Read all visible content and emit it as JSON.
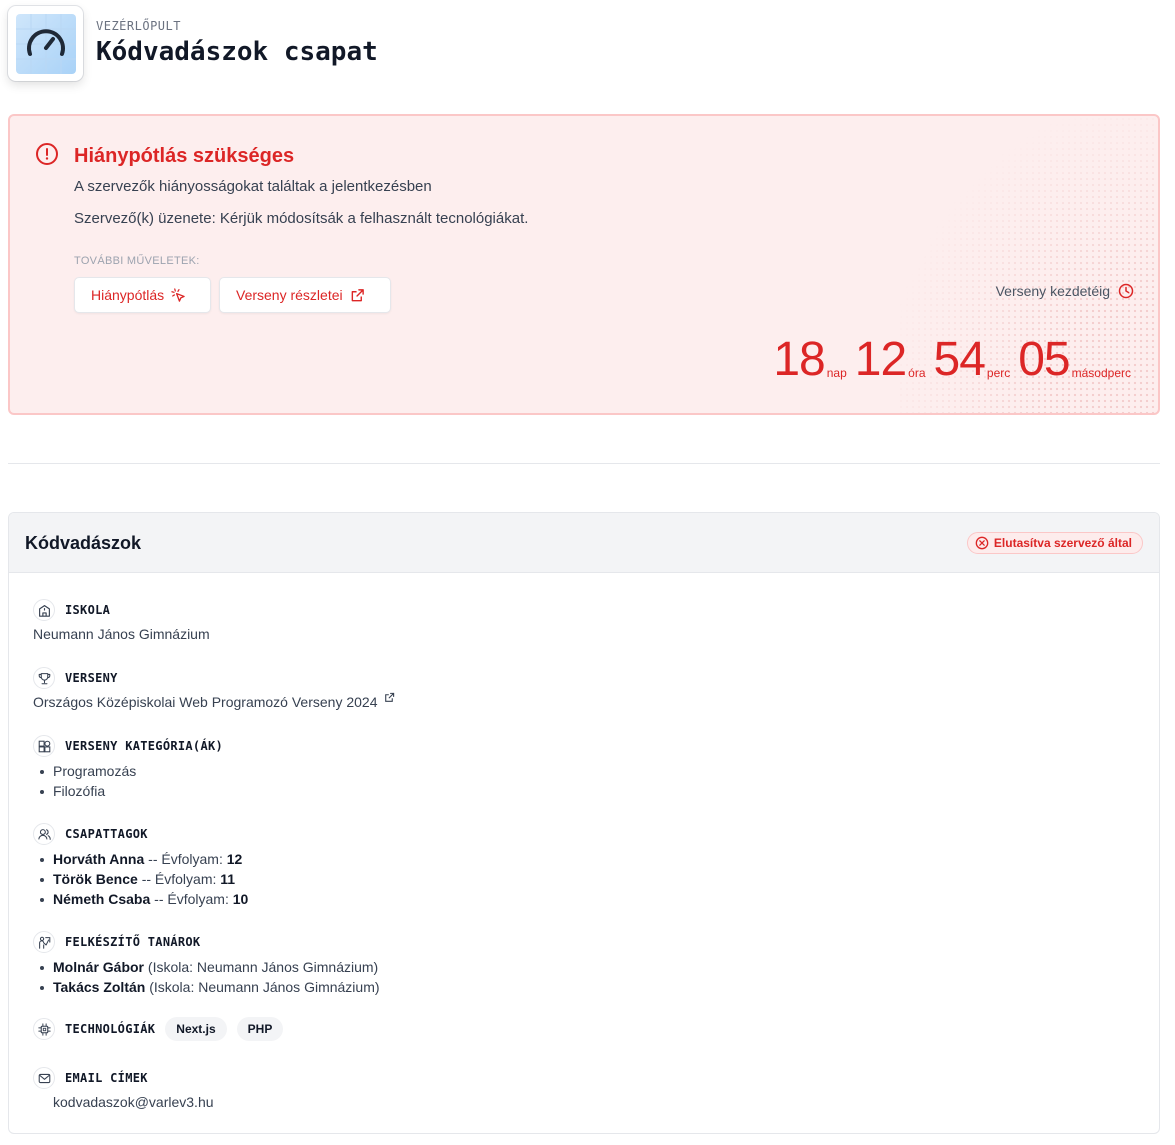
{
  "header": {
    "eyebrow": "VEZÉRLŐPULT",
    "title": "Kódvadászok csapat"
  },
  "alert": {
    "title": "Hiánypótlás szükséges",
    "line1": "A szervezők hiányosságokat találtak a jelentkezésben",
    "line2": "Szervező(k) üzenete: Kérjük módosítsák a felhasznált tecnológiákat.",
    "actions_label": "TOVÁBBI MŰVELETEK:",
    "button_fix": "Hiánypótlás",
    "button_details": "Verseny részletei",
    "countdown_label": "Verseny kezdetéig",
    "countdown": {
      "days": "18",
      "days_unit": "nap",
      "hours": "12",
      "hours_unit": "óra",
      "minutes": "54",
      "minutes_unit": "perc",
      "seconds": "05",
      "seconds_unit": "másodperc"
    },
    "color": "#dc2626"
  },
  "team": {
    "name": "Kódvadászok",
    "status": "Elutasítva szervező által",
    "school": {
      "label": "ISKOLA",
      "value": "Neumann János Gimnázium"
    },
    "competition": {
      "label": "VERSENY",
      "value": "Országos Középiskolai Web Programozó Verseny 2024"
    },
    "categories": {
      "label": "VERSENY KATEGÓRIA(ÁK)",
      "items": [
        "Programozás",
        "Filozófia"
      ]
    },
    "members": {
      "label": "CSAPATTAGOK",
      "grade_label": " -- Évfolyam: ",
      "items": [
        {
          "name": "Horváth Anna",
          "grade": "12"
        },
        {
          "name": "Török Bence",
          "grade": "11"
        },
        {
          "name": "Németh Csaba",
          "grade": "10"
        }
      ]
    },
    "teachers": {
      "label": "FELKÉSZÍTŐ TANÁROK",
      "items": [
        {
          "name": "Molnár Gábor",
          "school": " (Iskola: Neumann János Gimnázium)"
        },
        {
          "name": "Takács Zoltán",
          "school": " (Iskola: Neumann János Gimnázium)"
        }
      ]
    },
    "technologies": {
      "label": "TECHNOLÓGIÁK",
      "items": [
        "Next.js",
        "PHP"
      ]
    },
    "emails": {
      "label": "EMAIL CÍMEK",
      "value": "kodvadaszok@varlev3.hu"
    }
  }
}
